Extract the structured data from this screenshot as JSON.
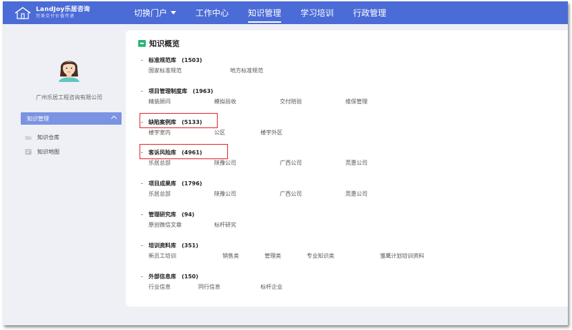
{
  "logo": {
    "title": "LandJoy乐居咨询",
    "subtitle": "完美交付价值传递"
  },
  "nav": [
    {
      "label": "切换门户",
      "has_caret": true
    },
    {
      "label": "工作中心"
    },
    {
      "label": "知识管理",
      "active": true
    },
    {
      "label": "学习培训"
    },
    {
      "label": "行政管理"
    }
  ],
  "sidebar": {
    "company": "广州乐居工程咨询有限公司",
    "menu_header": "知识管理",
    "items": [
      {
        "label": "知识仓库",
        "icon": "folder-icon"
      },
      {
        "label": "知识地图",
        "icon": "map-icon"
      }
    ]
  },
  "overview": {
    "title": "知识概览",
    "sections": [
      {
        "name": "标准规范库",
        "count": "(1503)",
        "items": [
          "国家标准规范",
          "地方标准规范"
        ]
      },
      {
        "name": "项目管理制度库",
        "count": "(1963)",
        "items": [
          "精装顾问",
          "模拟验收",
          "交付陪验",
          "维保管理"
        ]
      },
      {
        "name": "缺陷案例库",
        "count": "(5133)",
        "items": [
          "楼宇室内",
          "公区",
          "楼宇外区"
        ],
        "highlighted": true
      },
      {
        "name": "客诉风险库",
        "count": "(4961)",
        "items": [
          "乐居总部",
          "陕豫公司",
          "广西公司",
          "莞惠公司"
        ],
        "highlighted": true
      },
      {
        "name": "项目成果库",
        "count": "(1796)",
        "items": [
          "乐居总部",
          "陕豫公司",
          "广西公司",
          "莞惠公司"
        ]
      },
      {
        "name": "管理研究库",
        "count": "(94)",
        "items": [
          "原创微信文章",
          "标杆研究"
        ]
      },
      {
        "name": "培训资料库",
        "count": "(351)",
        "items": [
          "新员工培训",
          "销售类",
          "管理类",
          "专业知识类",
          "雏鹰计划培训资料"
        ]
      },
      {
        "name": "外部信息库",
        "count": "(150)",
        "items": [
          "行业信息",
          "同行信息",
          "标杆企业"
        ]
      }
    ]
  },
  "colors": {
    "topbar": "#4b6bd6",
    "menu_header": "#7b93e2",
    "highlight_box": "#e02020",
    "title_icon": "#2bb673"
  }
}
